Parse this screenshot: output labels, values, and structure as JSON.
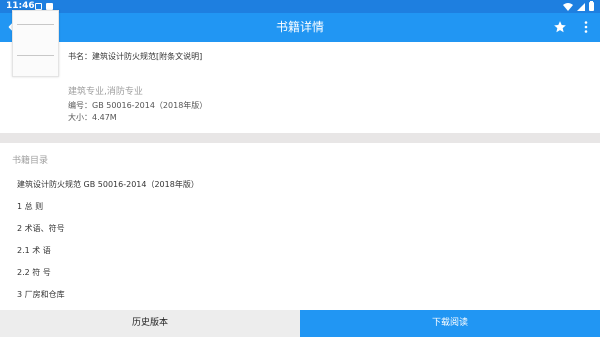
{
  "status_bar": {
    "time": "11:46"
  },
  "app_bar": {
    "title": "书籍详情",
    "back_icon": "arrow-back-icon",
    "favorite_icon": "star-icon",
    "menu_icon": "more-vertical-icon",
    "color": "#2196f3"
  },
  "book": {
    "name": "书名：建筑设计防火规范[附条文说明]",
    "category": "建筑专业,消防专业",
    "code": "编号：GB 50016-2014（2018年版）",
    "size": "大小：4.47M"
  },
  "toc": {
    "heading": "书籍目录",
    "items": [
      "建筑设计防火规范 GB 50016-2014（2018年版）",
      "1 总 则",
      "2 术语、符号",
      "2.1 术 语",
      "2.2 符 号",
      "3 厂房和仓库"
    ]
  },
  "actions": {
    "history_label": "历史版本",
    "download_label": "下载阅读"
  }
}
